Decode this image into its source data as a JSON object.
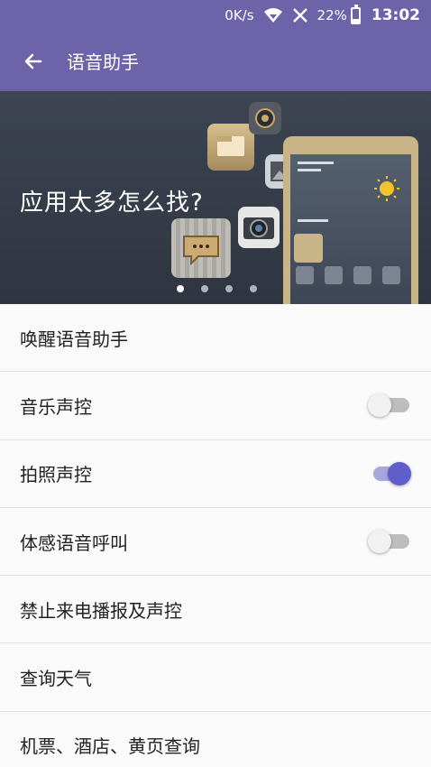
{
  "status_bar": {
    "net_speed": "0K/s",
    "battery_percent": "22%",
    "battery_level": 0.22,
    "time": "13:02",
    "icons": [
      "wifi-icon",
      "no-signal-icon",
      "battery-icon"
    ]
  },
  "app_bar": {
    "title": "语音助手",
    "back_icon": "arrow-back-icon"
  },
  "banner": {
    "text": "应用太多怎么找?",
    "pages": 4,
    "active_page": 1
  },
  "settings": [
    {
      "label": "唤醒语音助手"
    },
    {
      "label": "音乐声控",
      "toggle": false
    },
    {
      "label": "拍照声控",
      "toggle": true
    },
    {
      "label": "体感语音呼叫",
      "toggle": false
    },
    {
      "label": "禁止来电播报及声控"
    },
    {
      "label": "查询天气"
    },
    {
      "label": "机票、酒店、黄页查询"
    }
  ],
  "colors": {
    "primary": "#6c63a8",
    "toggle_on": "#5f5ecb",
    "toggle_off": "#bdbdbd"
  }
}
